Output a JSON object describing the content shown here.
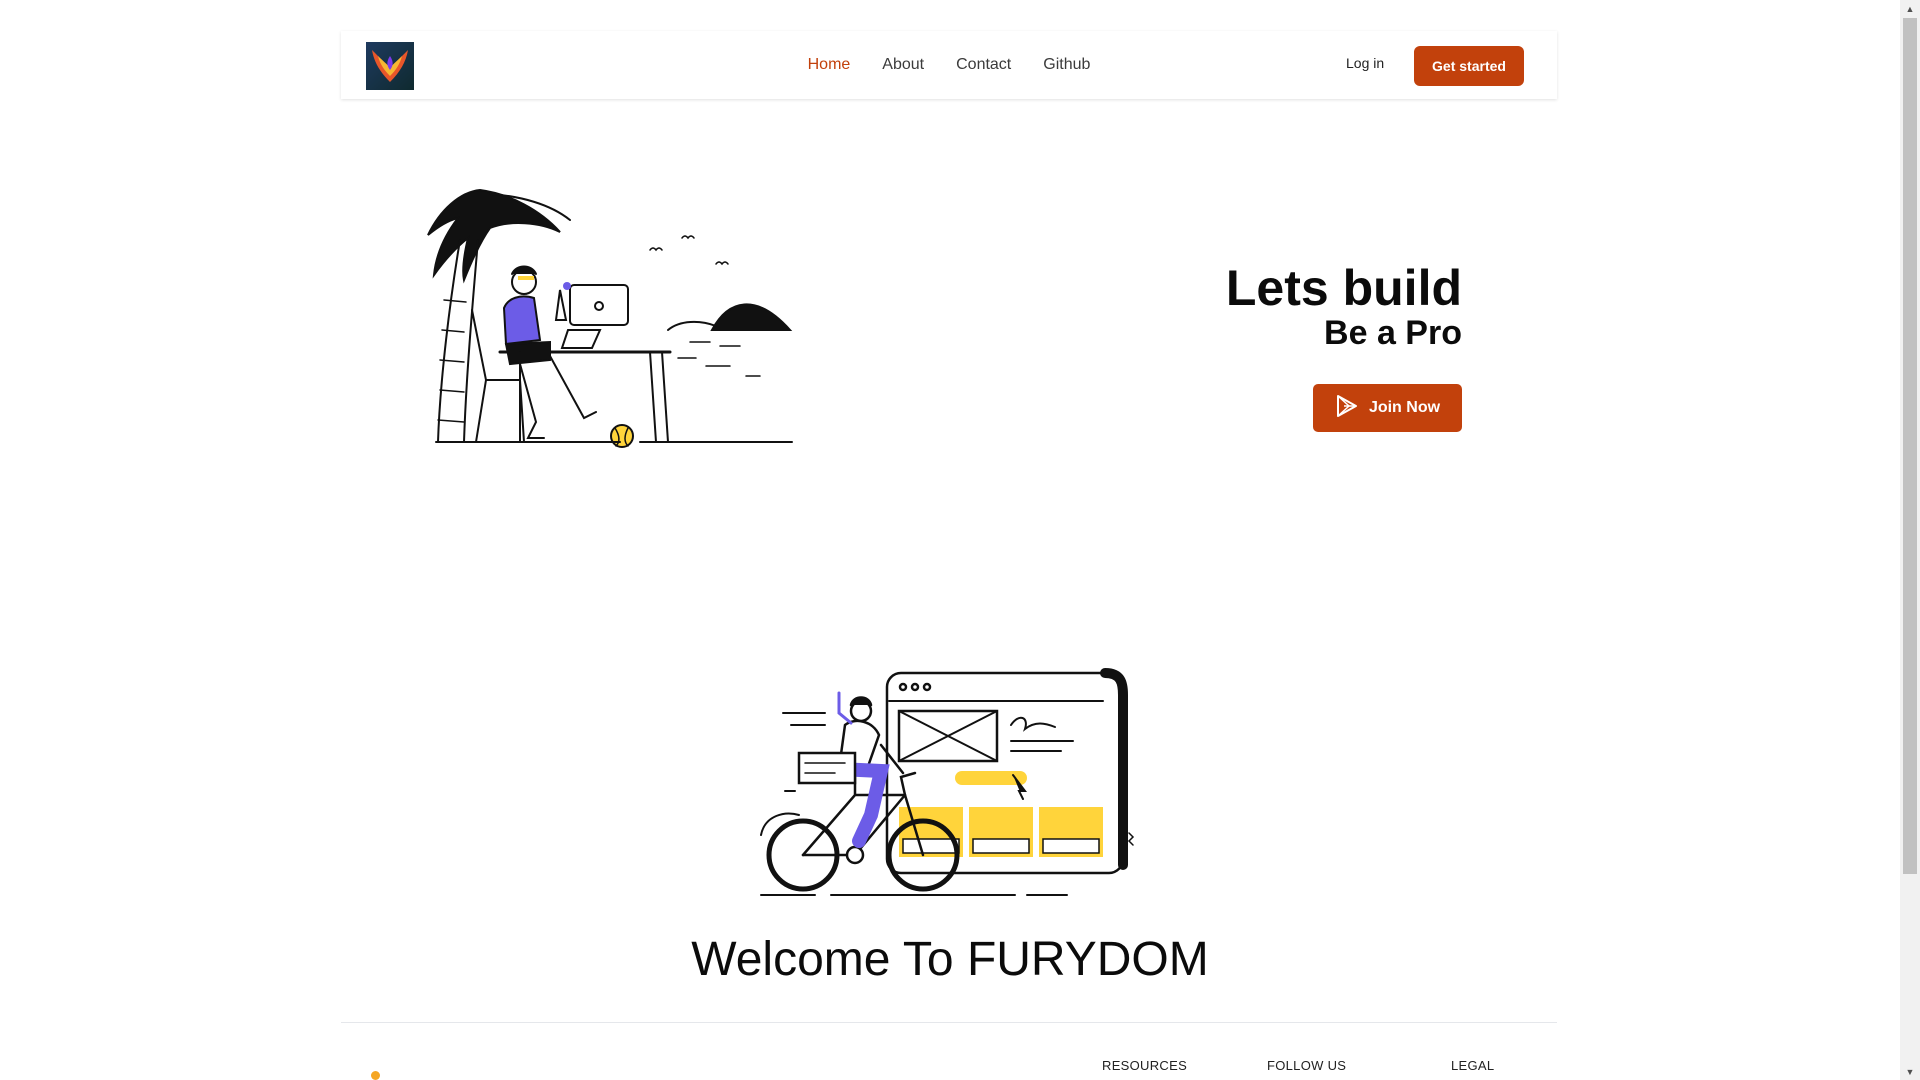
{
  "nav": {
    "links": [
      {
        "label": "Home"
      },
      {
        "label": "About"
      },
      {
        "label": "Contact"
      },
      {
        "label": "Github"
      }
    ],
    "login_label": "Log in",
    "cta_label": "Get started"
  },
  "hero": {
    "title": "Lets build",
    "subtitle": "Be a Pro",
    "button_label": "Join Now"
  },
  "welcome": {
    "title": "Welcome To FURYDOM"
  },
  "footer": {
    "columns": [
      "RESOURCES",
      "FOLLOW US",
      "LEGAL"
    ]
  },
  "colors": {
    "accent": "#c2410c",
    "illustration_purple": "#6c5ce7",
    "illustration_yellow": "#ffd43b"
  },
  "icons": {
    "logo": "phoenix-logo-icon",
    "join": "play-icon"
  }
}
